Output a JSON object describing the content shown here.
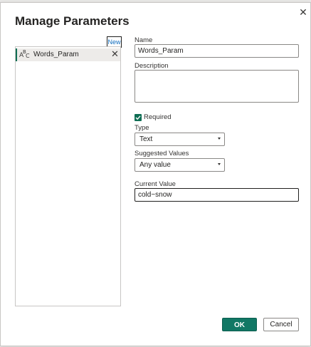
{
  "dialog": {
    "title": "Manage Parameters",
    "close_icon": "close-icon"
  },
  "list": {
    "new_label": "New",
    "items": [
      {
        "label": "Words_Param",
        "type_icon": "text-type-abc-icon",
        "delete_icon": "close-icon",
        "selected": true
      }
    ]
  },
  "form": {
    "name_label": "Name",
    "name_value": "Words_Param",
    "description_label": "Description",
    "description_value": "",
    "required_label": "Required",
    "required_checked": true,
    "type_label": "Type",
    "type_value": "Text",
    "suggested_label": "Suggested Values",
    "suggested_value": "Any value",
    "current_label": "Current Value",
    "current_value": "cold~snow"
  },
  "footer": {
    "ok_label": "OK",
    "cancel_label": "Cancel"
  },
  "colors": {
    "accent": "#117865",
    "selection_bar": "#0f6e54",
    "link": "#0f6cbd"
  }
}
